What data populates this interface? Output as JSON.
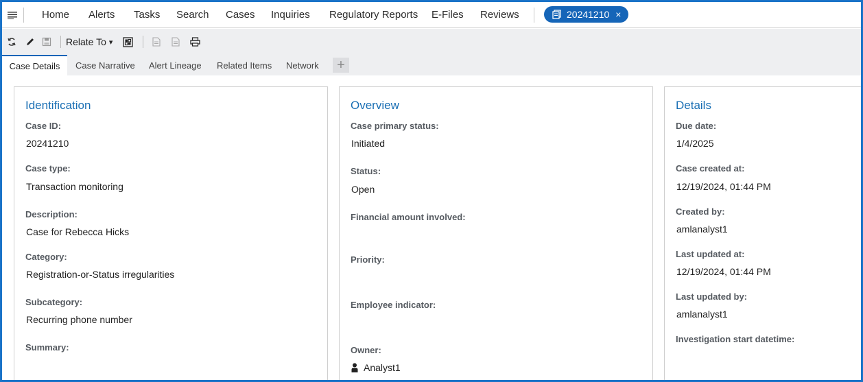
{
  "nav": {
    "items": [
      "Home",
      "Alerts",
      "Tasks",
      "Search",
      "Cases",
      "Inquiries",
      "Regulatory Reports",
      "E-Files",
      "Reviews"
    ],
    "open_case_tab": "20241210",
    "close_glyph": "×"
  },
  "toolbar": {
    "relate_to_label": "Relate To",
    "relate_to_caret": "▾"
  },
  "tabs": {
    "items": [
      "Case Details",
      "Case Narrative",
      "Alert Lineage",
      "Related Items",
      "Network"
    ],
    "active": "Case Details",
    "add_glyph": "+"
  },
  "identification": {
    "title": "Identification",
    "case_id_label": "Case ID:",
    "case_id": "20241210",
    "case_type_label": "Case type:",
    "case_type": "Transaction monitoring",
    "description_label": "Description:",
    "description": "Case for Rebecca Hicks",
    "category_label": "Category:",
    "category": "Registration-or-Status irregularities",
    "subcategory_label": "Subcategory:",
    "subcategory": "Recurring phone number",
    "summary_label": "Summary:"
  },
  "overview": {
    "title": "Overview",
    "primary_status_label": "Case primary status:",
    "primary_status": "Initiated",
    "status_label": "Status:",
    "status": "Open",
    "financial_label": "Financial amount involved:",
    "priority_label": "Priority:",
    "employee_label": "Employee indicator:",
    "owner_label": "Owner:",
    "owner": "Analyst1"
  },
  "details": {
    "title": "Details",
    "due_date_label": "Due date:",
    "due_date": "1/4/2025",
    "created_at_label": "Case created at:",
    "created_at": "12/19/2024, 01:44 PM",
    "created_by_label": "Created by:",
    "created_by": "amlanalyst1",
    "updated_at_label": "Last updated at:",
    "updated_at": "12/19/2024, 01:44 PM",
    "updated_by_label": "Last updated by:",
    "updated_by": "amlanalyst1",
    "investigation_label": "Investigation start datetime:"
  },
  "colors": {
    "accent": "#1565b8",
    "title_blue": "#1a6fb4",
    "frame": "#1a73c8"
  }
}
